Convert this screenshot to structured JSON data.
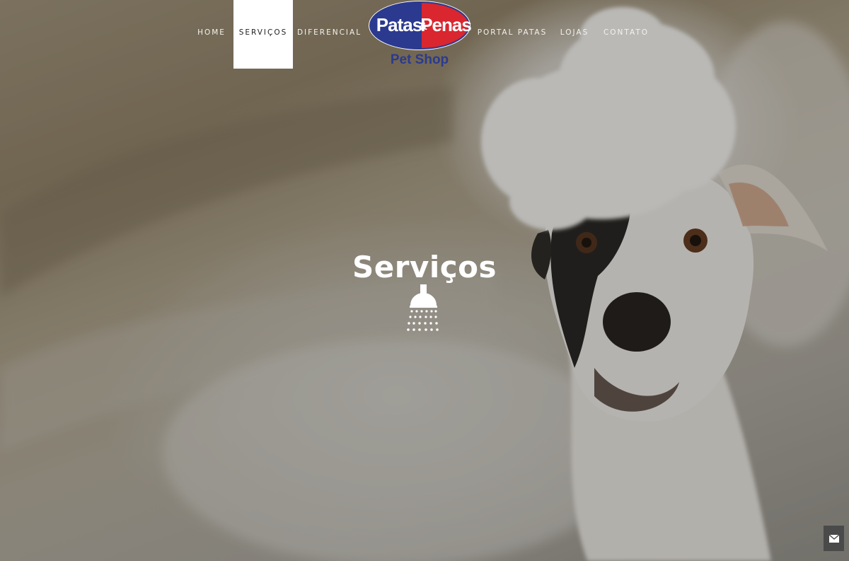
{
  "nav": {
    "items": [
      {
        "label": "HOME"
      },
      {
        "label": "SERVIÇOS"
      },
      {
        "label": "DIFERENCIAL"
      },
      {
        "label": "PORTAL PATAS"
      },
      {
        "label": "LOJAS"
      },
      {
        "label": "CONTATO"
      }
    ],
    "active_item": "SERVIÇOS"
  },
  "logo": {
    "line1_left": "Patas",
    "ampersand": "&",
    "line1_right": "Penas",
    "line2": "Pet Shop",
    "colors": {
      "blue": "#2b3a8f",
      "red": "#d9262f",
      "text": "#ffffff",
      "subtitle": "#2b3a8f"
    }
  },
  "hero": {
    "title": "Serviços",
    "icon": "shower-icon"
  },
  "contact_button": {
    "icon": "envelope-icon",
    "color": "#4a4a4a"
  }
}
